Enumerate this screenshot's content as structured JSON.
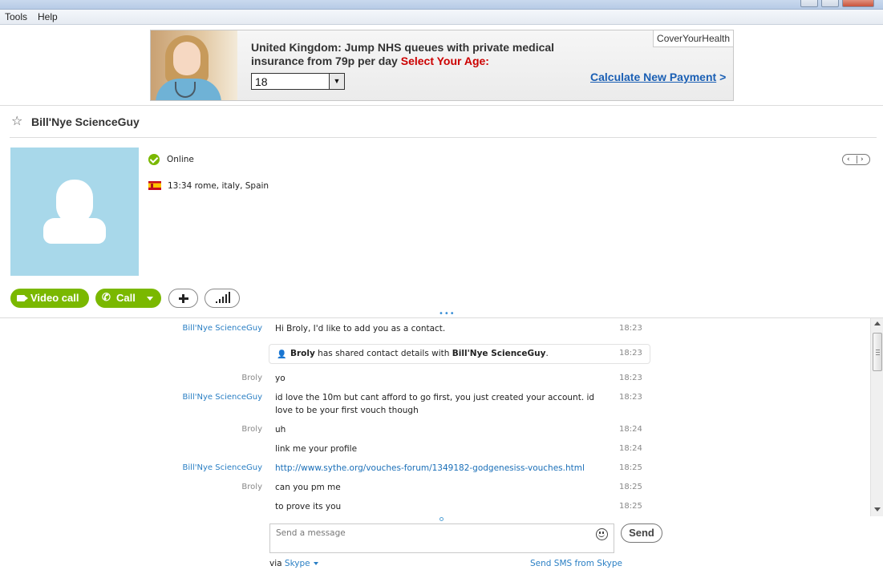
{
  "menu": {
    "items": [
      "Tools",
      "Help"
    ]
  },
  "ad": {
    "headline": "United Kingdom: Jump NHS queues with private medical insurance from 79p per day",
    "cta": "Select Your Age:",
    "age_value": "18",
    "link_text": "Calculate New Payment",
    "link_arrow": ">",
    "brand": "CoverYourHealth"
  },
  "contact": {
    "name": "Bill'Nye ScienceGuy",
    "status": "Online",
    "local_info": "13:34 rome, italy, Spain",
    "status_color": "#7ab800"
  },
  "actions": {
    "video_call": "Video call",
    "call": "Call"
  },
  "conversation": {
    "messages": [
      {
        "sender": "Bill'Nye ScienceGuy",
        "text": "Hi Broly, I'd like to add you as a contact.",
        "time": "18:23"
      },
      {
        "system": true,
        "actor": "Broly",
        "middle": " has shared contact details with ",
        "target": "Bill'Nye ScienceGuy",
        "end": ".",
        "time": "18:23"
      },
      {
        "sender": "Broly",
        "text": "yo",
        "time": "18:23"
      },
      {
        "sender": "Bill'Nye ScienceGuy",
        "text": "id love the 10m but cant afford to go first, you just created your account. id love to be your first vouch though",
        "time": "18:23"
      },
      {
        "sender": "Broly",
        "text": "uh",
        "time": "18:24"
      },
      {
        "sender": "",
        "text": "link me your profile",
        "time": "18:24"
      },
      {
        "sender": "Bill'Nye ScienceGuy",
        "text": "http://www.sythe.org/vouches-forum/1349182-godgenesiss-vouches.html",
        "time": "18:25"
      },
      {
        "sender": "Broly",
        "text": "can you pm me",
        "time": "18:25"
      },
      {
        "sender": "",
        "text": "to prove its you",
        "time": "18:25"
      }
    ]
  },
  "compose": {
    "placeholder": "Send a message",
    "send_label": "Send",
    "via_prefix": "via ",
    "via_service": "Skype",
    "sms_link": "Send SMS from Skype"
  },
  "colors": {
    "accent_green": "#7ab800",
    "link_blue": "#2a7fc4"
  }
}
